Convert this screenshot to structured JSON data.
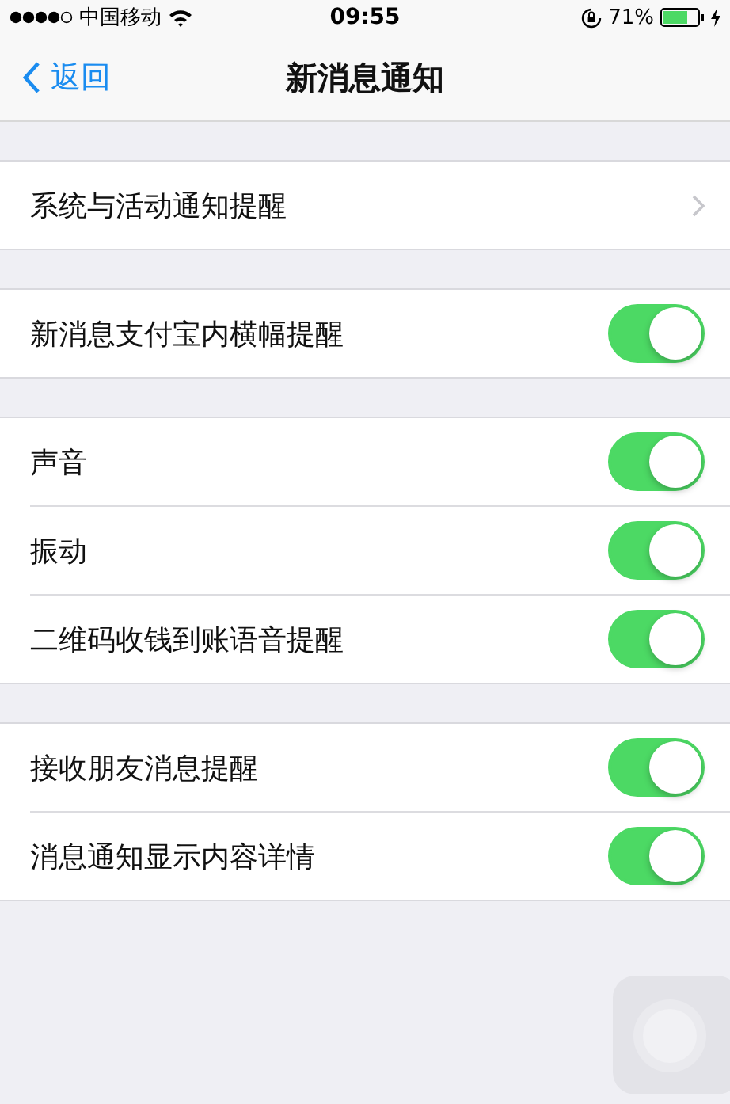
{
  "status_bar": {
    "carrier": "中国移动",
    "time": "09:55",
    "battery_percent": "71%"
  },
  "nav": {
    "back": "返回",
    "title": "新消息通知"
  },
  "groups": [
    {
      "rows": [
        {
          "kind": "link",
          "label": "系统与活动通知提醒"
        }
      ]
    },
    {
      "rows": [
        {
          "kind": "toggle",
          "label": "新消息支付宝内横幅提醒",
          "on": true
        }
      ]
    },
    {
      "rows": [
        {
          "kind": "toggle",
          "label": "声音",
          "on": true
        },
        {
          "kind": "toggle",
          "label": "振动",
          "on": true
        },
        {
          "kind": "toggle",
          "label": "二维码收钱到账语音提醒",
          "on": true
        }
      ]
    },
    {
      "rows": [
        {
          "kind": "toggle",
          "label": "接收朋友消息提醒",
          "on": true
        },
        {
          "kind": "toggle",
          "label": "消息通知显示内容详情",
          "on": true
        }
      ]
    }
  ]
}
